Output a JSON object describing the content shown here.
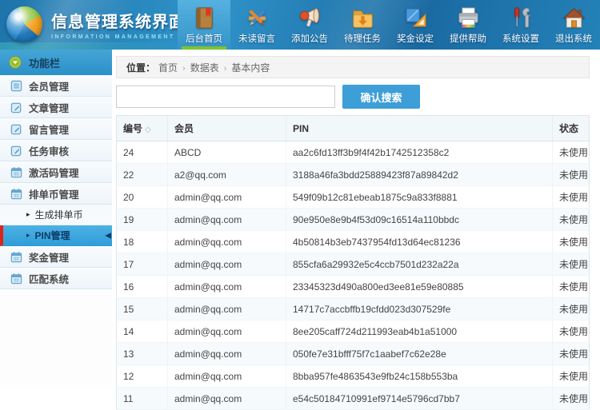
{
  "app": {
    "title": "信息管理系统界面",
    "subtitle": "INFORMATION MANAGEMENT SYSTEM GUI"
  },
  "nav": {
    "items": [
      {
        "label": "后台首页",
        "icon": "book-icon",
        "active": true
      },
      {
        "label": "未读留言",
        "icon": "pencil-icon",
        "active": false
      },
      {
        "label": "添加公告",
        "icon": "megaphone-icon",
        "active": false
      },
      {
        "label": "待理任务",
        "icon": "folder-download-icon",
        "active": false
      },
      {
        "label": "奖金设定",
        "icon": "ruler-icon",
        "active": false
      },
      {
        "label": "提供帮助",
        "icon": "printer-icon",
        "active": false
      },
      {
        "label": "系统设置",
        "icon": "tools-icon",
        "active": false
      },
      {
        "label": "退出系统",
        "icon": "home-icon",
        "active": false
      }
    ]
  },
  "sidebar": {
    "header": {
      "label": "功能栏",
      "icon": "circle-arrow-icon"
    },
    "items": [
      {
        "label": "会员管理",
        "icon": "list-icon"
      },
      {
        "label": "文章管理",
        "icon": "edit-icon"
      },
      {
        "label": "留言管理",
        "icon": "edit-icon"
      },
      {
        "label": "任务审核",
        "icon": "edit-icon"
      },
      {
        "label": "激活码管理",
        "icon": "calendar-icon"
      },
      {
        "label": "排单币管理",
        "icon": "calendar-icon",
        "children": [
          {
            "label": "生成排单币",
            "active": false
          },
          {
            "label": "PIN管理",
            "active": true
          }
        ]
      },
      {
        "label": "奖金管理",
        "icon": "calendar-icon"
      },
      {
        "label": "匹配系统",
        "icon": "calendar-icon"
      }
    ]
  },
  "breadcrumb": {
    "label": "位置：",
    "items": [
      "首页",
      "数据表",
      "基本内容"
    ]
  },
  "search": {
    "value": "",
    "button_label": "确认搜索"
  },
  "table": {
    "columns": [
      {
        "label": "编号",
        "sortable": true
      },
      {
        "label": "会员",
        "sortable": false
      },
      {
        "label": "PIN",
        "sortable": false
      },
      {
        "label": "状态",
        "sortable": false
      }
    ],
    "rows": [
      {
        "id": "24",
        "member": "ABCD",
        "pin": "aa2c6fd13ff3b9f4f42b1742512358c2",
        "status": "未使用"
      },
      {
        "id": "22",
        "member": "a2@qq.com",
        "pin": "3188a46fa3bdd25889423f87a89842d2",
        "status": "未使用"
      },
      {
        "id": "20",
        "member": "admin@qq.com",
        "pin": "549f09b12c81ebeab1875c9a833f8881",
        "status": "未使用"
      },
      {
        "id": "19",
        "member": "admin@qq.com",
        "pin": "90e950e8e9b4f53d09c16514a110bbdc",
        "status": "未使用"
      },
      {
        "id": "18",
        "member": "admin@qq.com",
        "pin": "4b50814b3eb7437954fd13d64ec81236",
        "status": "未使用"
      },
      {
        "id": "17",
        "member": "admin@qq.com",
        "pin": "855cfa6a29932e5c4ccb7501d232a22a",
        "status": "未使用"
      },
      {
        "id": "16",
        "member": "admin@qq.com",
        "pin": "23345323d490a800ed3ee81e59e80885",
        "status": "未使用"
      },
      {
        "id": "15",
        "member": "admin@qq.com",
        "pin": "14717c7accbffb19cfdd023d307529fe",
        "status": "未使用"
      },
      {
        "id": "14",
        "member": "admin@qq.com",
        "pin": "8ee205caff724d211993eab4b1a51000",
        "status": "未使用"
      },
      {
        "id": "13",
        "member": "admin@qq.com",
        "pin": "050fe7e31bfff75f7c1aabef7c62e28e",
        "status": "未使用"
      },
      {
        "id": "12",
        "member": "admin@qq.com",
        "pin": "8bba957fe4863543e9fb24c158b553ba",
        "status": "未使用"
      },
      {
        "id": "11",
        "member": "admin@qq.com",
        "pin": "e54c50184710991ef9714e5796cd7bb7",
        "status": "未使用"
      }
    ]
  },
  "colors": {
    "accent_blue": "#3d9ed8",
    "active_green": "#7cc32c",
    "alert_red": "#e02318",
    "header_blue": "#2f93c9",
    "sidebar_active_blue": "#3ba7de"
  }
}
